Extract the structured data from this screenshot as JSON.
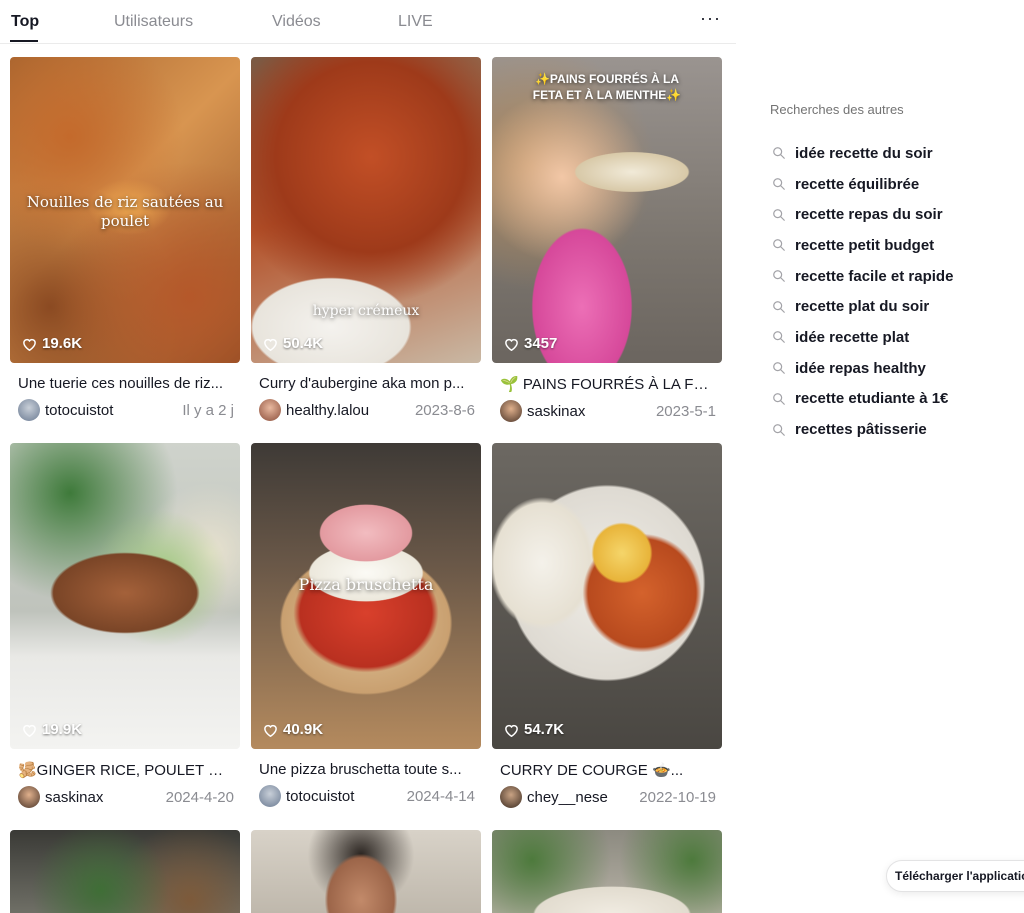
{
  "tabs": [
    "Top",
    "Utilisateurs",
    "Vidéos",
    "LIVE"
  ],
  "more_label": "···",
  "videos": [
    {
      "likes": "19.6K",
      "overlay": "Nouilles de riz sautées au poulet",
      "desc": "Une tuerie ces nouilles de riz...",
      "user": "totocuistot",
      "date": "Il y a 2 j"
    },
    {
      "likes": "50.4K",
      "overlay": "hyper crémeux",
      "desc": "Curry d'aubergine aka mon p...",
      "user": "healthy.lalou",
      "date": "2023-8-6"
    },
    {
      "likes": "3457",
      "overlay": "✨PAINS FOURRÉS À LA FETA ET À LA MENTHE✨",
      "desc": "🌱 PAINS FOURRÉS À LA FE...",
      "user": "saskinax",
      "date": "2023-5-1"
    },
    {
      "likes": "19.9K",
      "overlay": "",
      "desc": "🫚GINGER RICE, POULET MI...",
      "user": "saskinax",
      "date": "2024-4-20"
    },
    {
      "likes": "40.9K",
      "overlay": "Pizza bruschetta",
      "desc": "Une pizza bruschetta toute s...",
      "user": "totocuistot",
      "date": "2024-4-14"
    },
    {
      "likes": "54.7K",
      "overlay": "",
      "desc": "CURRY DE COURGE 🍲...",
      "user": "chey__nese",
      "date": "2022-10-19"
    }
  ],
  "sidebar": {
    "title": "Recherches des autres",
    "items": [
      "idée recette du soir",
      "recette équilibrée",
      "recette repas du soir",
      "recette petit budget",
      "recette facile et rapide",
      "recette plat du soir",
      "idée recette plat",
      "idée repas healthy",
      "recette etudiante à 1€",
      "recettes pâtisserie"
    ]
  },
  "download_label": "Télécharger l'application"
}
